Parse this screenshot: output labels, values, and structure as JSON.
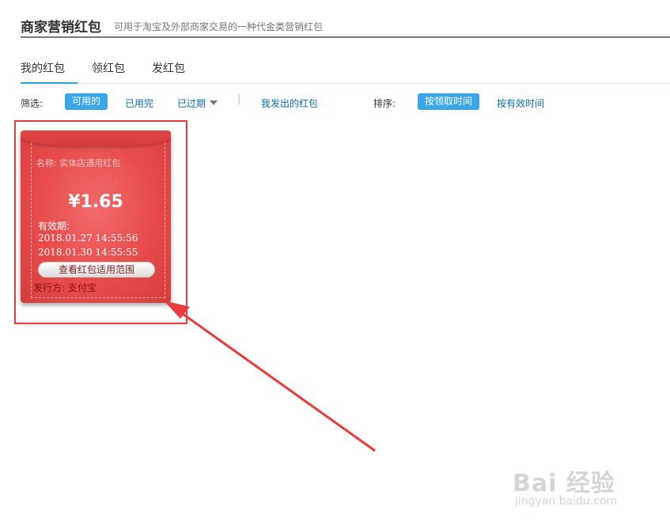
{
  "header": {
    "title": "商家营销红包",
    "subtitle": "可用于淘宝及外部商家交易的一种代金类营销红包"
  },
  "tabs": [
    {
      "label": "我的红包",
      "active": true
    },
    {
      "label": "领红包",
      "active": false
    },
    {
      "label": "发红包",
      "active": false
    }
  ],
  "filter": {
    "label": "筛选:",
    "options": {
      "available": "可用的",
      "used_up": "已用完",
      "expired": "已过期"
    },
    "separator": "|",
    "sent_by_me": "我发出的红包"
  },
  "sort": {
    "label": "排序:",
    "by_receive_time": "按领取时间",
    "by_valid_time": "按有效时间"
  },
  "card": {
    "name": "名称: 实体店通用红包",
    "amount": "¥1.65",
    "validity_label": "有效期:",
    "date_start": "2018.01.27 14:55:56",
    "date_end": "2018.01.30 14:55:55",
    "scope_button": "查看红包适用范围",
    "issuer": "发行方: 支付宝"
  },
  "watermark": {
    "main": "Bai 经验",
    "sub": "jingyan.baidu.com"
  },
  "colors": {
    "accent": "#3aa8e8",
    "link": "#0a6ea8",
    "card_red": "#e74b4b",
    "annotation_red": "#e83b3b"
  }
}
